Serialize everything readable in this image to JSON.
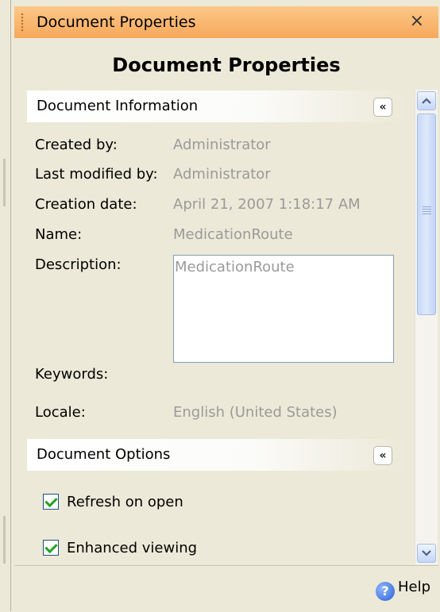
{
  "window": {
    "title": "Document Properties"
  },
  "pane": {
    "heading": "Document Properties"
  },
  "document_information": {
    "section_label": "Document Information",
    "fields": {
      "created_by_label": "Created by:",
      "created_by_value": "Administrator",
      "last_modified_by_label": "Last modified by:",
      "last_modified_by_value": "Administrator",
      "creation_date_label": "Creation date:",
      "creation_date_value": "April 21, 2007 1:18:17 AM",
      "name_label": "Name:",
      "name_value": "MedicationRoute",
      "description_label": "Description:",
      "description_value": "MedicationRoute",
      "keywords_label": "Keywords:",
      "locale_label": "Locale:",
      "locale_value": "English (United States)"
    }
  },
  "document_options": {
    "section_label": "Document Options",
    "options": [
      {
        "label": "Refresh on open",
        "checked": true
      },
      {
        "label": "Enhanced viewing",
        "checked": true
      }
    ]
  },
  "footer": {
    "help_label": "Help"
  },
  "icons": {
    "close": "close-icon",
    "collapse": "double-chevron-up-icon",
    "help": "help-question-icon",
    "scroll_up": "arrow-up-icon",
    "scroll_down": "arrow-down-icon"
  },
  "colors": {
    "titlebar": "#f6a85b",
    "pane_background": "#ece9d8",
    "checkmark": "#21a121",
    "scrollbar_accent": "#c6d6f7"
  }
}
